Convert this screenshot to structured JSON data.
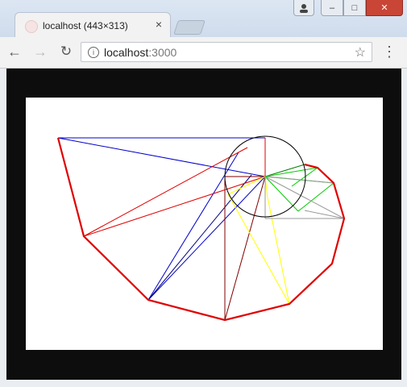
{
  "browser": {
    "tab_title": "localhost (443×313)",
    "url_host": "localhost",
    "url_port": ":3000",
    "icons": {
      "back": "back-arrow-icon",
      "forward": "forward-arrow-icon",
      "reload": "reload-icon",
      "info": "info-icon",
      "bookmark": "star-icon",
      "menu": "kebab-menu-icon",
      "tab_close": "close-icon"
    },
    "window_buttons": [
      "user",
      "minimize",
      "maximize",
      "close"
    ]
  },
  "canvas": {
    "colors": {
      "hull": "#e00000",
      "circle": "#000000",
      "series": [
        "#0000cc",
        "#000080",
        "#800000",
        "#e00000",
        "#ffff00",
        "#00cc00",
        "#008000",
        "#999999"
      ]
    }
  }
}
